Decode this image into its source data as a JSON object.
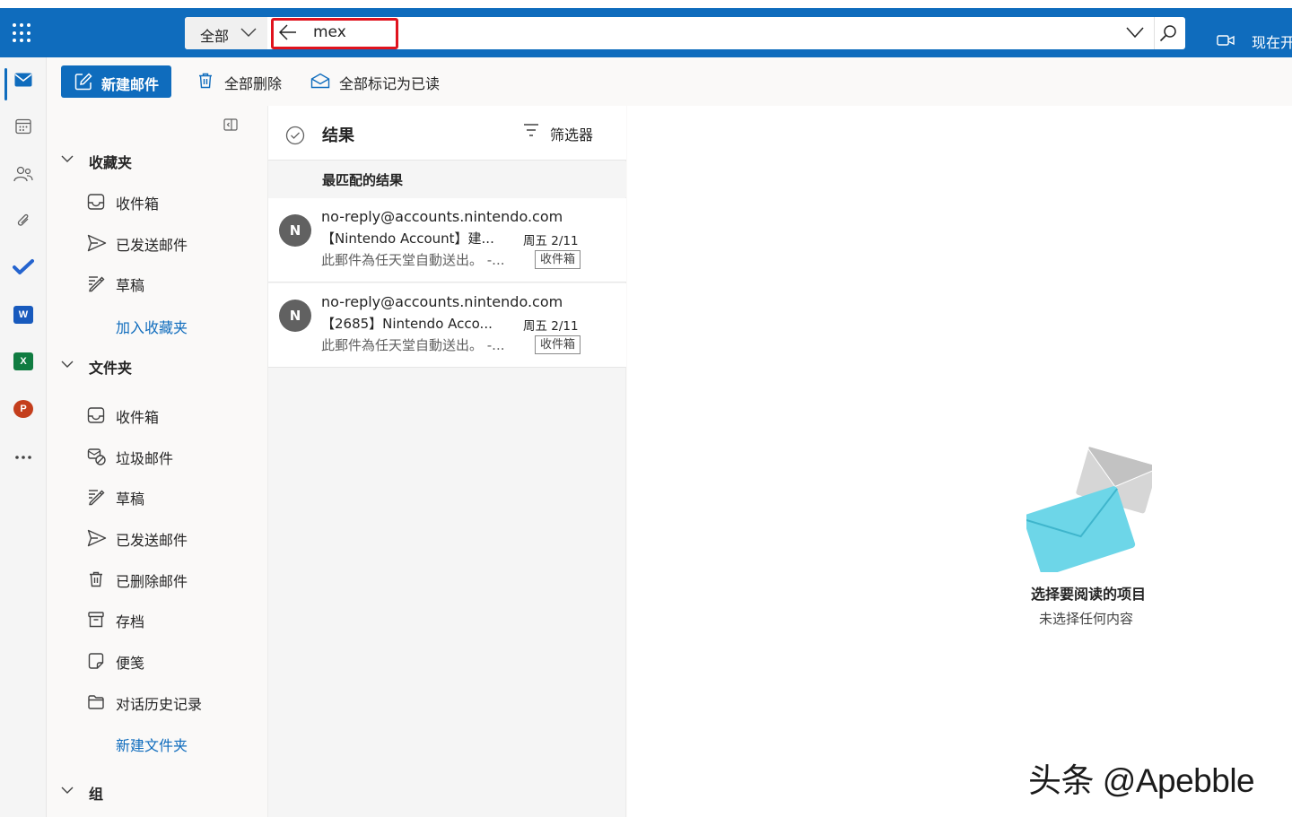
{
  "search": {
    "scope_label": "全部",
    "query": "mex"
  },
  "topbar": {
    "meet_label": "现在开"
  },
  "commands": {
    "new_mail": "新建邮件",
    "delete_all": "全部删除",
    "mark_all_read": "全部标记为已读"
  },
  "favorites": {
    "title": "收藏夹",
    "items": [
      {
        "label": "收件箱",
        "icon": "inbox-icon"
      },
      {
        "label": "已发送邮件",
        "icon": "send-icon"
      },
      {
        "label": "草稿",
        "icon": "draft-icon"
      }
    ],
    "add_link": "加入收藏夹"
  },
  "folders": {
    "title": "文件夹",
    "items": [
      {
        "label": "收件箱",
        "icon": "inbox-icon"
      },
      {
        "label": "垃圾邮件",
        "icon": "junk-icon"
      },
      {
        "label": "草稿",
        "icon": "draft-icon"
      },
      {
        "label": "已发送邮件",
        "icon": "send-icon"
      },
      {
        "label": "已删除邮件",
        "icon": "trash-icon"
      },
      {
        "label": "存档",
        "icon": "archive-icon"
      },
      {
        "label": "便笺",
        "icon": "note-icon"
      },
      {
        "label": "对话历史记录",
        "icon": "folder-icon"
      }
    ],
    "new_link": "新建文件夹"
  },
  "groups": {
    "title": "组"
  },
  "results": {
    "title": "结果",
    "filter_label": "筛选器",
    "group_label": "最匹配的结果",
    "messages": [
      {
        "avatar": "N",
        "sender": "no-reply@accounts.nintendo.com",
        "subject": "【Nintendo Account】建...",
        "date": "周五 2/11",
        "preview": "此郵件為任天堂自動送出。 -...",
        "folder": "收件箱"
      },
      {
        "avatar": "N",
        "sender": "no-reply@accounts.nintendo.com",
        "subject": "【2685】Nintendo Acco...",
        "date": "周五 2/11",
        "preview": "此郵件為任天堂自動送出。 -...",
        "folder": "收件箱"
      }
    ]
  },
  "reading_pane": {
    "title": "选择要阅读的项目",
    "subtitle": "未选择任何内容"
  },
  "watermark": "头条 @Apebble",
  "colors": {
    "brand": "#0f6cbd",
    "highlight": "#e0131e",
    "envelope_front": "#6dd6e8",
    "envelope_back": "#d4d4d4"
  },
  "rail_apps": [
    "mail-icon",
    "calendar-icon",
    "people-icon",
    "attachment-icon",
    "todo-icon",
    "word-icon",
    "excel-icon",
    "powerpoint-icon",
    "more-apps-icon"
  ]
}
